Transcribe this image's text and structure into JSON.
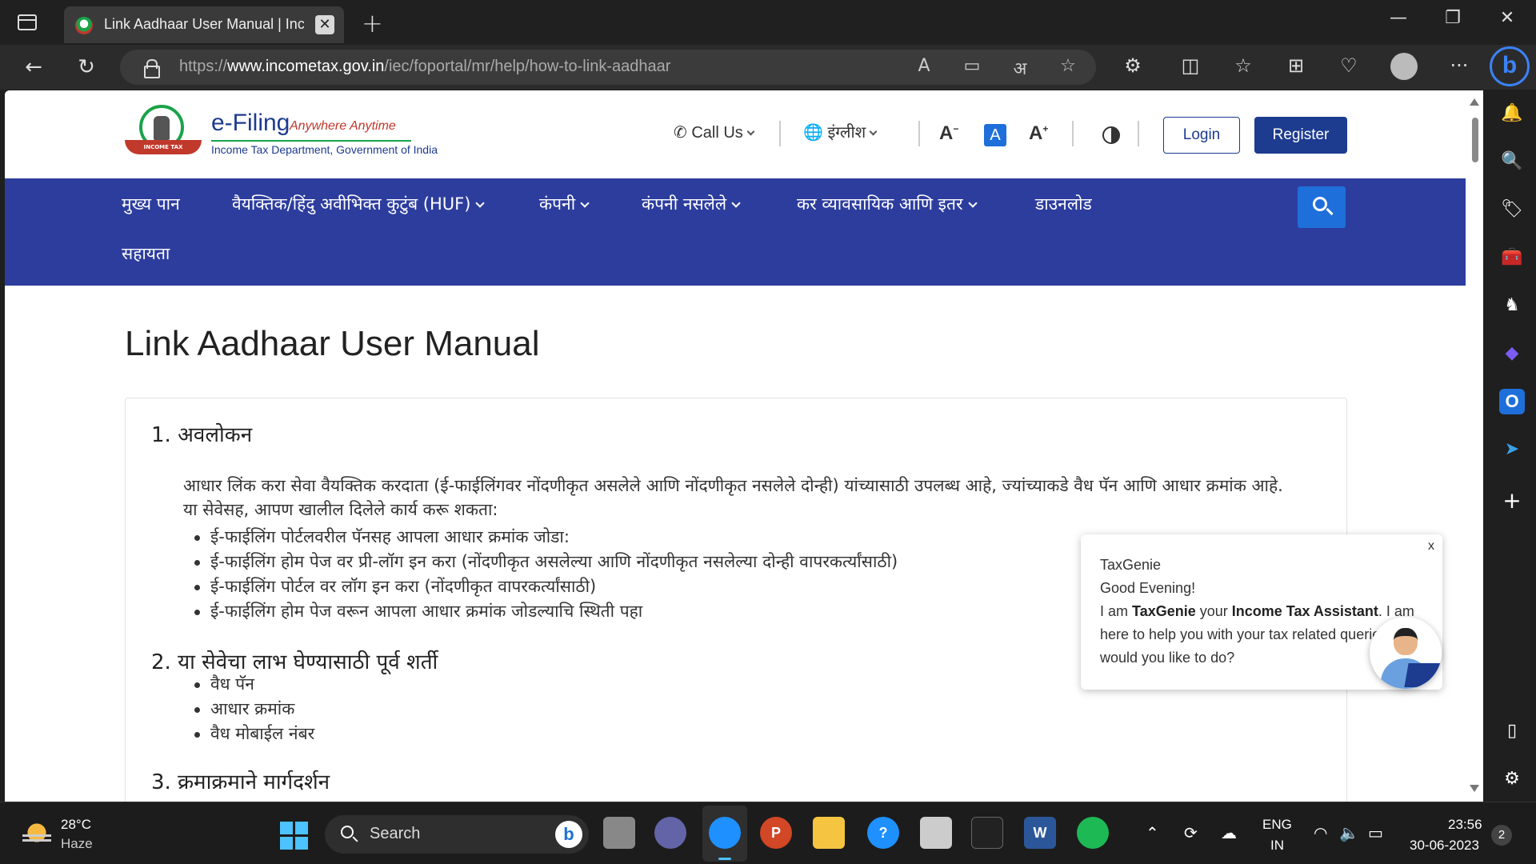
{
  "browser": {
    "tab_title": "Link Aadhaar User Manual | Income Tax Department",
    "tab_close": "✕",
    "new_tab": "+",
    "url_prefix": "https://",
    "url_host": "www.incometax.gov.in",
    "url_path": "/iec/foportal/mr/help/how-to-link-aadhaar",
    "window_controls": {
      "minimize": "—",
      "restore": "❐",
      "close": "✕"
    },
    "nav": {
      "back": "←",
      "refresh": "↻"
    },
    "omnibox_icons": {
      "read_aloud": "A",
      "immersive": "▭",
      "translate": "अ",
      "favorite": "☆"
    },
    "toolbar_icons": {
      "extensions": "⚙",
      "split": "◫",
      "favorites": "☆",
      "collections": "⊞",
      "health": "♡",
      "more": "···"
    },
    "bing": "b"
  },
  "sidebar": {
    "icons": [
      {
        "name": "bell-icon",
        "glyph": "🔔",
        "color": "#1e90ff"
      },
      {
        "name": "search-icon",
        "glyph": "🔍",
        "color": "#ffffff"
      },
      {
        "name": "tag-icon",
        "glyph": "🏷",
        "color": "#4c8bf5"
      },
      {
        "name": "toolbox-icon",
        "glyph": "🧰",
        "color": "#e0603a"
      },
      {
        "name": "chess-icon",
        "glyph": "♞",
        "color": "#bbbbbb"
      },
      {
        "name": "copilot-icon",
        "glyph": "◆",
        "color": "#7a5cf5"
      },
      {
        "name": "outlook-icon",
        "glyph": "O",
        "color": "#1e6fd9"
      },
      {
        "name": "send-icon",
        "glyph": "➤",
        "color": "#3aa0e8"
      }
    ],
    "add": "+",
    "panel": "▯",
    "settings": "⚙"
  },
  "site": {
    "brand_title": "e-Filing",
    "brand_tagline": "Anywhere Anytime",
    "brand_sub": "Income Tax Department, Government of India",
    "emblem_text": "INCOME TAX DEPARTMENT",
    "call_us": "Call Us",
    "language": "इंग्लीश",
    "font_decrease": "A",
    "font_normal": "A",
    "font_increase": "A",
    "login": "Login",
    "register": "Register"
  },
  "main_nav": {
    "items": [
      {
        "label": "मुख्य पान",
        "dropdown": false
      },
      {
        "label": "वैयक्तिक/हिंदु अवीभिक्त कुटुंब (HUF)",
        "dropdown": true
      },
      {
        "label": "कंपनी",
        "dropdown": true
      },
      {
        "label": "कंपनी नसलेले",
        "dropdown": true
      },
      {
        "label": "कर व्यावसायिक आणि इतर",
        "dropdown": true
      },
      {
        "label": "डाउनलोड",
        "dropdown": false
      },
      {
        "label": "सहायता",
        "dropdown": false
      }
    ]
  },
  "content": {
    "page_title": "Link Aadhaar User Manual",
    "section1": {
      "heading": "1. अवलोकन",
      "paragraph": "आधार लिंक करा सेवा वैयक्तिक करदाता (ई-फाईलिंगवर नोंदणीकृत असलेले आणि नोंदणीकृत नसलेले दोन्ही) यांच्यासाठी उपलब्ध आहे, ज्यांच्याकडे वैध पॅन आणि आधार क्रमांक आहे. या सेवेसह, आपण खालील दिलेले कार्य करू शकता:",
      "bullets": [
        "ई-फाईलिंग पोर्टलवरील पॅनसह आपला आधार क्रमांक जोडा:",
        "ई-फाईलिंग होम पेज वर प्री-लॉग इन करा (नोंदणीकृत असलेल्या आणि नोंदणीकृत नसलेल्या दोन्ही वापरकर्त्यांसाठी)",
        "ई-फाईलिंग पोर्टल वर लॉग इन करा (नोंदणीकृत वापरकर्त्यांसाठी)",
        "ई-फाईलिंग होम पेज वरून आपला आधार क्रमांक जोडल्याचि स्थिती पहा"
      ]
    },
    "section2": {
      "heading": "2. या सेवेचा लाभ घेण्यासाठी पूर्व शर्ती",
      "bullets": [
        "वैध पॅन",
        "आधार क्रमांक",
        "वैध मोबाईल नंबर"
      ]
    },
    "section3": {
      "heading": "3. क्रमाक्रमाने मार्गदर्शन"
    }
  },
  "taxgenie": {
    "close": "x",
    "name": "TaxGenie",
    "greeting": "Good Evening!",
    "line_prefix": "I am",
    "line_name": "TaxGenie",
    "line_mid": "your",
    "line_role": "Income Tax Assistant",
    "line_rest": ". I am here to help you with your tax related queries.What would you like to do?"
  },
  "taskbar": {
    "temp": "28°C",
    "condition": "Haze",
    "search_label": "Search",
    "lang_top": "ENG",
    "lang_bottom": "IN",
    "time": "23:56",
    "date": "30-06-2023",
    "notifications": "2",
    "apps": [
      {
        "name": "file-explorer-icon",
        "label": "",
        "color": "#888888"
      },
      {
        "name": "teams-icon",
        "label": "",
        "color": "#6264a7"
      },
      {
        "name": "edge-icon",
        "label": "",
        "color": "#1e90ff"
      },
      {
        "name": "powerpoint-icon",
        "label": "P",
        "color": "#d24726"
      },
      {
        "name": "folder-icon",
        "label": "",
        "color": "#f5c542"
      },
      {
        "name": "help-icon",
        "label": "?",
        "color": "#1e90ff"
      },
      {
        "name": "notepad-icon",
        "label": "",
        "color": "#cccccc"
      },
      {
        "name": "mysql-icon",
        "label": "",
        "color": "#222222"
      },
      {
        "name": "word-icon",
        "label": "W",
        "color": "#2b579a"
      },
      {
        "name": "spotify-icon",
        "label": "",
        "color": "#1db954"
      }
    ]
  }
}
